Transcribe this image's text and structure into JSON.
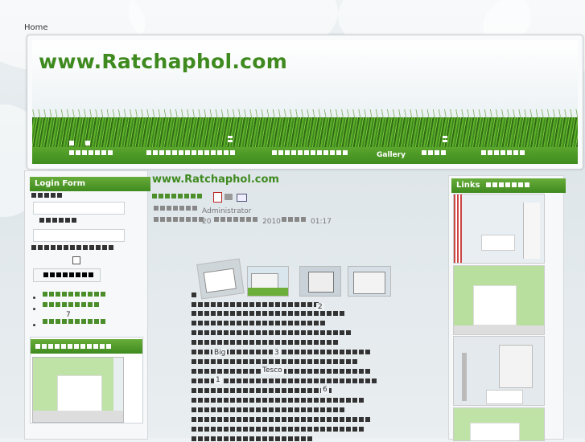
{
  "nav": {
    "home": "Home"
  },
  "site": {
    "title": "www.Ratchaphol.com"
  },
  "menu": {
    "gallery": "Gallery"
  },
  "login": {
    "title": "Login Form"
  },
  "article": {
    "title": "www.Ratchaphol.com",
    "author": "Administrator",
    "date_day": "20",
    "date_year": "2010",
    "time": "01:17",
    "word_big": "Big",
    "word_tesco": "Tesco",
    "num_1": "1",
    "num_2": "2",
    "num_3": "3",
    "num_6": "6",
    "num_7": "7"
  },
  "right": {
    "links_title": "Links"
  },
  "colors": {
    "brand_green": "#3f8a1f",
    "nav_green": "#4b8e2a"
  },
  "icons": [
    "pdf-icon",
    "print-icon",
    "email-icon"
  ]
}
